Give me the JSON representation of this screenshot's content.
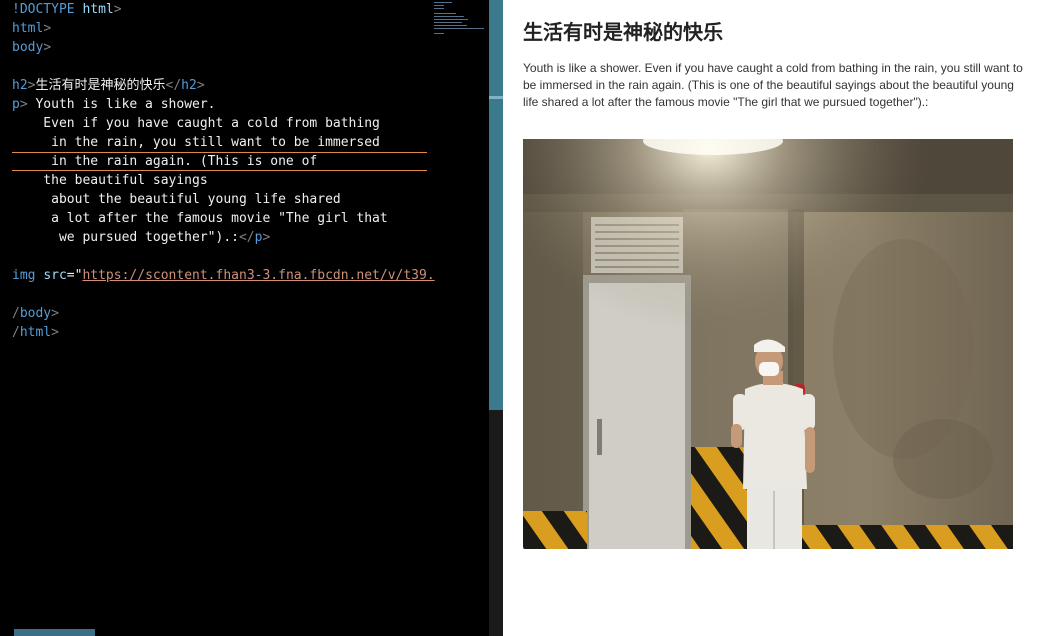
{
  "editor": {
    "lines": [
      {
        "kind": "plain",
        "parts": [
          {
            "c": "tk-tag",
            "t": "!DOCTYPE "
          },
          {
            "c": "tk-attr",
            "t": "html"
          },
          {
            "c": "tk-bracket",
            "t": ">"
          }
        ]
      },
      {
        "kind": "plain",
        "parts": [
          {
            "c": "tk-tag",
            "t": "html"
          },
          {
            "c": "tk-bracket",
            "t": ">"
          }
        ]
      },
      {
        "kind": "plain",
        "parts": [
          {
            "c": "tk-tag",
            "t": "body"
          },
          {
            "c": "tk-bracket",
            "t": ">"
          }
        ]
      },
      {
        "kind": "plain",
        "parts": []
      },
      {
        "kind": "plain",
        "parts": [
          {
            "c": "tk-tag",
            "t": "h2"
          },
          {
            "c": "tk-bracket",
            "t": ">"
          },
          {
            "c": "tk-txt",
            "t": "生活有时是神秘的快乐"
          },
          {
            "c": "tk-bracket",
            "t": "</"
          },
          {
            "c": "tk-tag",
            "t": "h2"
          },
          {
            "c": "tk-bracket",
            "t": ">"
          }
        ]
      },
      {
        "kind": "plain",
        "parts": [
          {
            "c": "tk-tag",
            "t": "p"
          },
          {
            "c": "tk-bracket",
            "t": "> "
          },
          {
            "c": "tk-txt",
            "t": "Youth is like a shower."
          }
        ]
      },
      {
        "kind": "plain",
        "parts": [
          {
            "c": "tk-txt",
            "t": "    Even if you have caught a cold from bathing"
          }
        ]
      },
      {
        "kind": "plain",
        "parts": [
          {
            "c": "tk-txt",
            "t": "     in the rain, you still want to be immersed"
          }
        ]
      },
      {
        "kind": "plain",
        "parts": [
          {
            "c": "tk-txt",
            "t": "     in the rain again. (This is one of"
          }
        ]
      },
      {
        "kind": "plain",
        "parts": [
          {
            "c": "tk-txt",
            "t": "    the beautiful sayings"
          }
        ]
      },
      {
        "kind": "plain",
        "parts": [
          {
            "c": "tk-txt",
            "t": "     about the beautiful young life shared"
          }
        ]
      },
      {
        "kind": "plain",
        "parts": [
          {
            "c": "tk-txt",
            "t": "     a lot after the famous movie \"The girl that"
          }
        ]
      },
      {
        "kind": "plain",
        "parts": [
          {
            "c": "tk-txt",
            "t": "      we pursued together\").:"
          },
          {
            "c": "tk-bracket",
            "t": "</"
          },
          {
            "c": "tk-tag",
            "t": "p"
          },
          {
            "c": "tk-bracket",
            "t": ">"
          }
        ]
      },
      {
        "kind": "plain",
        "parts": []
      },
      {
        "kind": "plain",
        "parts": [
          {
            "c": "tk-tag",
            "t": "img "
          },
          {
            "c": "tk-attr",
            "t": "src"
          },
          {
            "c": "tk-txt",
            "t": "=\""
          },
          {
            "c": "tk-str",
            "t": "https://scontent.fhan3-3.fna.fbcdn.net/v/t39."
          }
        ]
      },
      {
        "kind": "plain",
        "parts": []
      },
      {
        "kind": "plain",
        "parts": [
          {
            "c": "tk-bracket",
            "t": "/"
          },
          {
            "c": "tk-tag",
            "t": "body"
          },
          {
            "c": "tk-bracket",
            "t": ">"
          }
        ]
      },
      {
        "kind": "plain",
        "parts": [
          {
            "c": "tk-bracket",
            "t": "/"
          },
          {
            "c": "tk-tag",
            "t": "html"
          },
          {
            "c": "tk-bracket",
            "t": ">"
          }
        ]
      }
    ]
  },
  "preview": {
    "heading": "生活有时是神秘的快乐",
    "paragraph": "Youth is like a shower. Even if you have caught a cold from bathing in the rain, you still want to be immersed in the rain again. (This is one of the beautiful sayings about the beautiful young life shared a lot after the famous movie \"The girl that we pursued together\").:"
  },
  "colors": {
    "editor_bg": "#000000",
    "tag": "#569cd6",
    "string": "#ce9178",
    "scrollbar": "#3b7a8c",
    "highlight": "#e08a4a"
  }
}
